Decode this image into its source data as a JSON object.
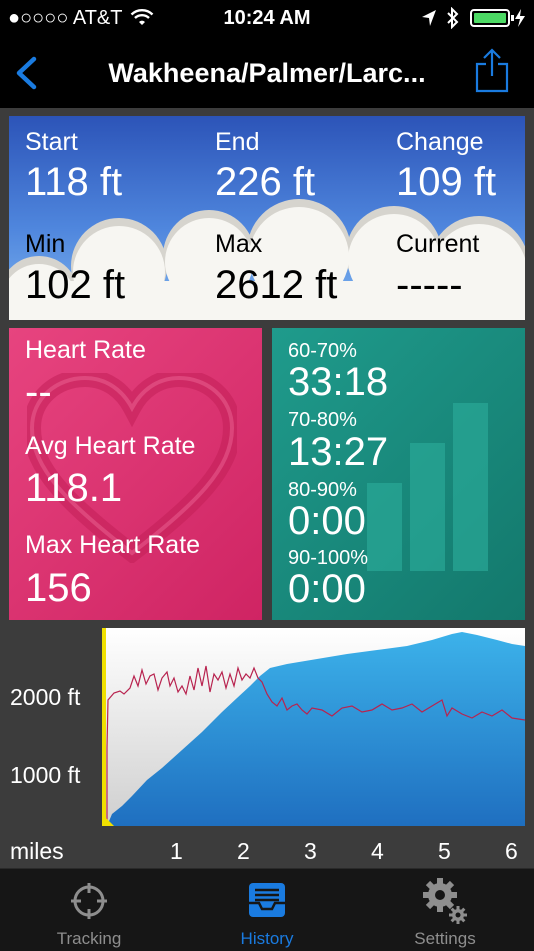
{
  "status_bar": {
    "carrier": "●○○○○ AT&T",
    "time": "10:24 AM"
  },
  "nav": {
    "title": "Wakheena/Palmer/Larc..."
  },
  "elevation": {
    "start_label": "Start",
    "start_value": "118 ft",
    "end_label": "End",
    "end_value": "226 ft",
    "change_label": "Change",
    "change_value": "109 ft",
    "min_label": "Min",
    "min_value": "102 ft",
    "max_label": "Max",
    "max_value": "2612 ft",
    "current_label": "Current",
    "current_value": "-----"
  },
  "heart": {
    "hr_label": "Heart Rate",
    "hr_value": "--",
    "avg_label": "Avg Heart Rate",
    "avg_value": "118.1",
    "max_label": "Max Heart Rate",
    "max_value": "156"
  },
  "zones": [
    {
      "label": "60-70%",
      "value": "33:18"
    },
    {
      "label": "70-80%",
      "value": "13:27"
    },
    {
      "label": "80-90%",
      "value": "0:00"
    },
    {
      "label": "90-100%",
      "value": "0:00"
    }
  ],
  "graph": {
    "y_labels": [
      "2000 ft",
      "1000 ft"
    ],
    "x_unit": "miles",
    "x_labels": [
      "1",
      "2",
      "3",
      "4",
      "5",
      "6"
    ],
    "colors": {
      "elevation": "#2a92d8",
      "heart_rate": "#b8234f",
      "marker": "#f0e000"
    }
  },
  "tabs": [
    {
      "label": "Tracking",
      "icon": "crosshair-icon",
      "active": false
    },
    {
      "label": "History",
      "icon": "inbox-tray-icon",
      "active": true
    },
    {
      "label": "Settings",
      "icon": "gears-icon",
      "active": false
    }
  ],
  "colors": {
    "accent": "#1a7be0",
    "heart_panel": "#dd3470",
    "zone_panel": "#1a8a7c",
    "sky": "#3d6fd0"
  }
}
